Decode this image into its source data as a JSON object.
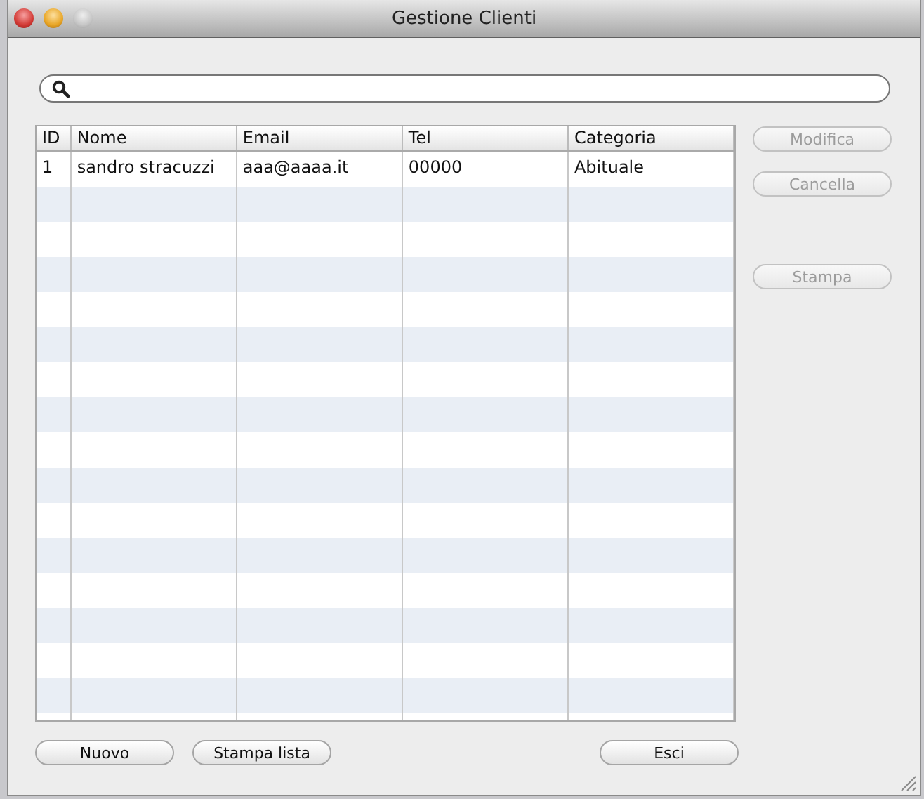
{
  "window": {
    "title": "Gestione Clienti"
  },
  "table": {
    "columns": [
      "ID",
      "Nome",
      "Email",
      "Tel",
      "Categoria"
    ],
    "rows": [
      {
        "cells": [
          "1",
          "sandro stracuzzi",
          "aaa@aaaa.it",
          "00000",
          "Abituale"
        ]
      }
    ]
  },
  "side_buttons": [
    {
      "label": "Modifica",
      "disabled": true
    },
    {
      "label": "Cancella",
      "disabled": true
    },
    {
      "label": "Stampa",
      "disabled": true
    }
  ],
  "bottom_buttons": [
    {
      "label": "Nuovo",
      "disabled": false
    },
    {
      "label": "Stampa lista",
      "disabled": false
    },
    {
      "label": "Esci",
      "disabled": false
    }
  ]
}
